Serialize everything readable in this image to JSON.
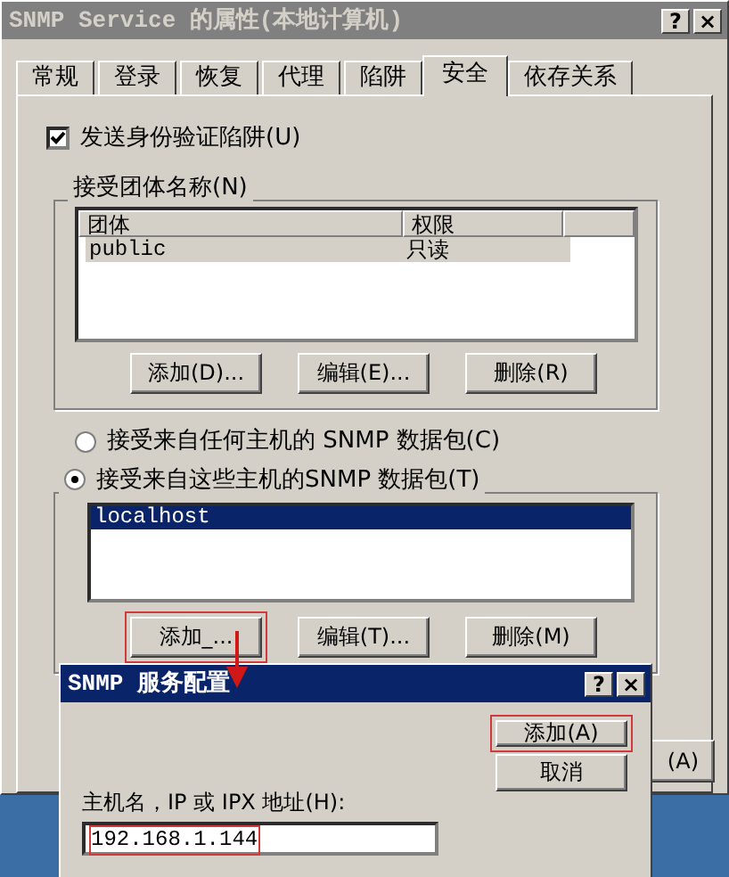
{
  "window": {
    "title": "SNMP Service 的属性(本地计算机)",
    "help": "?",
    "close": "×"
  },
  "tabs": [
    {
      "label": "常规",
      "selected": false
    },
    {
      "label": "登录",
      "selected": false
    },
    {
      "label": "恢复",
      "selected": false
    },
    {
      "label": "代理",
      "selected": false
    },
    {
      "label": "陷阱",
      "selected": false
    },
    {
      "label": "安全",
      "selected": true
    },
    {
      "label": "依存关系",
      "selected": false
    }
  ],
  "send_auth_trap": {
    "label": "发送身份验证陷阱(U)",
    "checked": true
  },
  "communities": {
    "title": "接受团体名称(N)",
    "columns": [
      "团体",
      "权限"
    ],
    "rows": [
      {
        "cells": [
          "public",
          "只读"
        ],
        "selected": true
      }
    ],
    "buttons": [
      {
        "label": "添加(D)...",
        "highlighted": false
      },
      {
        "label": "编辑(E)...",
        "highlighted": false
      },
      {
        "label": "删除(R)",
        "highlighted": false
      }
    ]
  },
  "host_options": [
    {
      "label": "接受来自任何主机的 SNMP 数据包(C)",
      "selected": false
    },
    {
      "label": "接受来自这些主机的SNMP 数据包(T)",
      "selected": true
    }
  ],
  "hosts": {
    "rows": [
      {
        "name": "localhost",
        "selected": true
      }
    ],
    "buttons": [
      {
        "label": "添加_...",
        "highlighted": true
      },
      {
        "label": "编辑(T)...",
        "highlighted": false
      },
      {
        "label": "删除(M)",
        "highlighted": false
      }
    ]
  },
  "apply_button": "(A)",
  "sub_dialog": {
    "title": "SNMP 服务配置",
    "help": "?",
    "close": "×",
    "buttons": [
      {
        "label": "添加(A)",
        "highlighted": true
      },
      {
        "label": "取消",
        "highlighted": false
      }
    ],
    "field_label": "主机名，IP 或 IPX 地址(H):",
    "value": "192.168.1.144",
    "value_highlighted": true
  }
}
